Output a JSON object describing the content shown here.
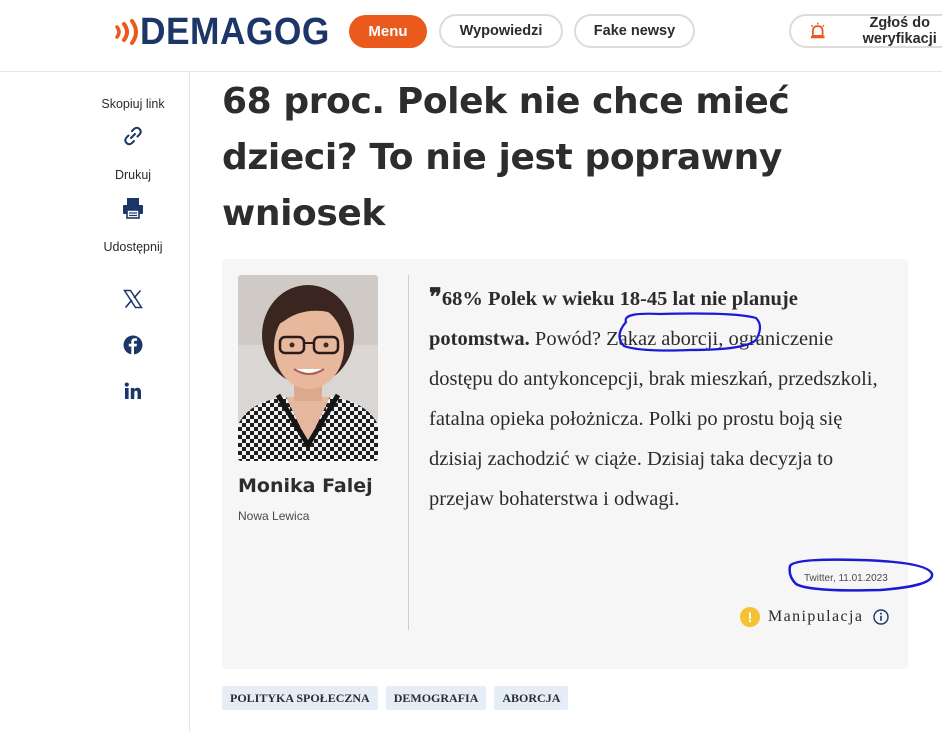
{
  "header": {
    "logo_text": "DEMAGOG",
    "brand_color": "#1c3669",
    "accent_color": "#ea5a1c",
    "menu_label": "Menu",
    "nav": [
      "Wypowiedzi",
      "Fake newsy"
    ],
    "report_label": "Zgłoś do weryfikacji",
    "report_icon": "siren-icon"
  },
  "sidebar": {
    "copy_label": "Skopiuj link",
    "copy_icon": "link-icon",
    "print_label": "Drukuj",
    "print_icon": "printer-icon",
    "share_label": "Udostępnij",
    "share_icons": [
      "x-icon",
      "facebook-icon",
      "linkedin-icon"
    ]
  },
  "article": {
    "title": "68 proc. Polek nie chce mieć dzieci? To nie jest poprawny wniosek"
  },
  "statement": {
    "author_name": "Monika Falej",
    "author_party": "Nowa Lewica",
    "quote_bold": "68% Polek w wieku 18-45 lat nie planuje potomstwa.",
    "quote_before_mark": " Powód? ",
    "quote_marked": "Zakaz aborcji,",
    "quote_rest": " ograniczenie dostępu do antykoncepcji, brak mieszkań, przedszkoli, fatalna opieka położnicza. Polki po prostu boją się dzisiaj zachodzić w ciąże. Dzisiaj taka decyzja to przejaw bohaterstwa i odwagi.",
    "source": "Twitter, 11.01.2023",
    "verdict": "Manipulacja",
    "verdict_symbol": "!",
    "verdict_color": "#f4c232"
  },
  "tags": [
    "POLITYKA SPOŁECZNA",
    "DEMOGRAFIA",
    "ABORCJA"
  ],
  "annotation_color": "#1b1bd6"
}
